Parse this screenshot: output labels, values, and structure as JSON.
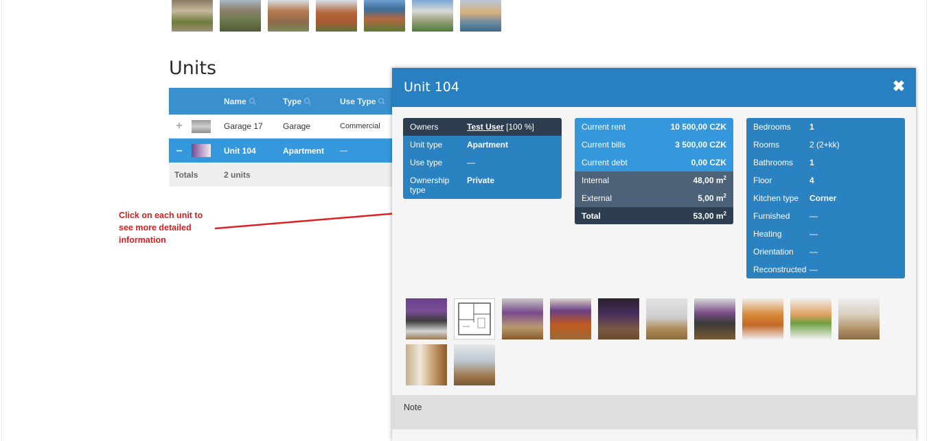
{
  "top_gallery": {
    "count": 7
  },
  "units": {
    "title": "Units",
    "columns": {
      "name": "Name",
      "type": "Type",
      "use_type": "Use Type"
    },
    "rows": [
      {
        "expand": "+",
        "name": "Garage 17",
        "type": "Garage",
        "use_type": "Commercial"
      },
      {
        "expand": "–",
        "name": "Unit 104",
        "type": "Apartment",
        "use_type": "—"
      }
    ],
    "totals": {
      "label": "Totals",
      "value": "2 units"
    }
  },
  "annotation": {
    "line1": "Click on each unit to",
    "line2": "see more detailed",
    "line3": "information"
  },
  "modal": {
    "title": "Unit 104",
    "close": "✖",
    "owners": {
      "owners_label": "Owners",
      "owner_name": "Test User",
      "owner_share": "[100 %]",
      "unit_type_label": "Unit type",
      "unit_type": "Apartment",
      "use_type_label": "Use type",
      "use_type": "—",
      "ownership_label_1": "Ownership",
      "ownership_label_2": "type",
      "ownership_type": "Private"
    },
    "finance": {
      "rent_label": "Current rent",
      "rent": "10 500,00 CZK",
      "bills_label": "Current bills",
      "bills": "3 500,00 CZK",
      "debt_label": "Current debt",
      "debt": "0,00 CZK",
      "internal_label": "Internal",
      "internal": "48,00 m",
      "external_label": "External",
      "external": "5,00 m",
      "total_label": "Total",
      "total": "53,00 m",
      "area_sup": "2"
    },
    "details": [
      {
        "label": "Bedrooms",
        "value": "1"
      },
      {
        "label": "Rooms",
        "value": "2 (2+kk)"
      },
      {
        "label": "Bathrooms",
        "value": "1"
      },
      {
        "label": "Floor",
        "value": "4"
      },
      {
        "label": "Kitchen type",
        "value": "Corner"
      },
      {
        "label": "Furnished",
        "value": "—"
      },
      {
        "label": "Heating",
        "value": "—"
      },
      {
        "label": "Orientation",
        "value": "—"
      },
      {
        "label": "Reconstructed",
        "value": "—"
      }
    ],
    "photo_count": 12,
    "note_label": "Note"
  }
}
